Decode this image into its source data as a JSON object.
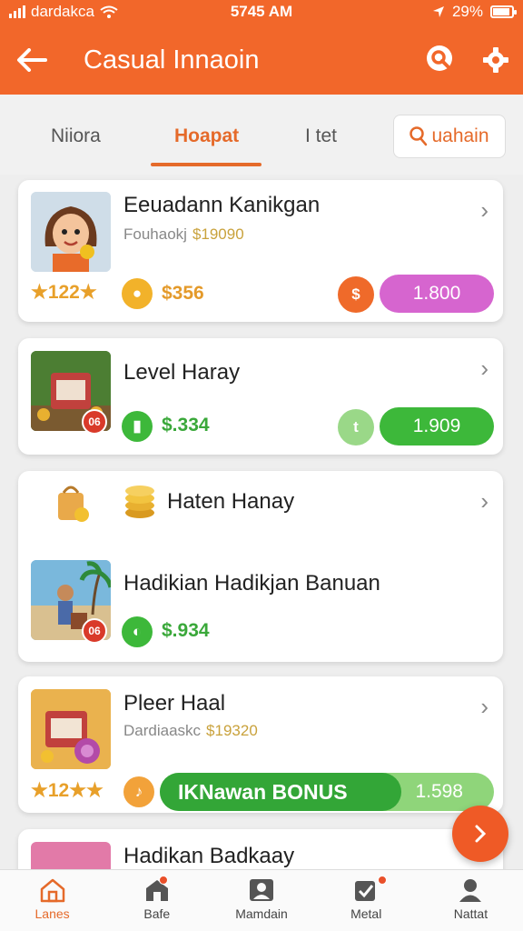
{
  "status_bar": {
    "carrier": "dardakca",
    "time": "5745 AM",
    "battery": "29%"
  },
  "app_bar": {
    "title": "Casual Innaoin",
    "back_icon": "back-arrow-icon",
    "search_icon": "search-icon",
    "settings_icon": "gear-icon"
  },
  "tabs": {
    "items": [
      {
        "label": "Niiora"
      },
      {
        "label": "Hoapat",
        "active": true
      },
      {
        "label": "I tet"
      }
    ],
    "search_button": "uahain"
  },
  "cards": [
    {
      "name": "Eeuadann Kanikgan",
      "subtitle": "Fouhaokj",
      "price": "$19090",
      "rating": "122",
      "coin_value": "$356",
      "mid_button": "$",
      "action": "1.800"
    },
    {
      "name": "Level Haray",
      "badge": "06",
      "coin_value": "$.334",
      "mid_button": "t",
      "action": "1.909"
    },
    {
      "name": "Haten Hanay",
      "name2": "Hadikian Hadikjan Banuan",
      "badge": "06",
      "coin_value": "$.934"
    },
    {
      "name": "Pleer Haal",
      "subtitle": "Dardiaaskc",
      "price": "$19320",
      "rating": "12",
      "coin_value": "♪",
      "bonus_label": "IKNawan BONUS",
      "bonus_value": "1.598"
    },
    {
      "name": "Hadikan Badkaay"
    }
  ],
  "bottom_nav": [
    {
      "label": "Lanes",
      "icon": "home-icon",
      "active": true
    },
    {
      "label": "Bafe",
      "icon": "store-icon"
    },
    {
      "label": "Mamdain",
      "icon": "portrait-icon"
    },
    {
      "label": "Metal",
      "icon": "tasks-icon"
    },
    {
      "label": "Nattat",
      "icon": "profile-icon"
    }
  ],
  "colors": {
    "primary": "#f2672a",
    "green": "#3db83a",
    "purple": "#d665cf",
    "gold": "#e8a02a"
  }
}
